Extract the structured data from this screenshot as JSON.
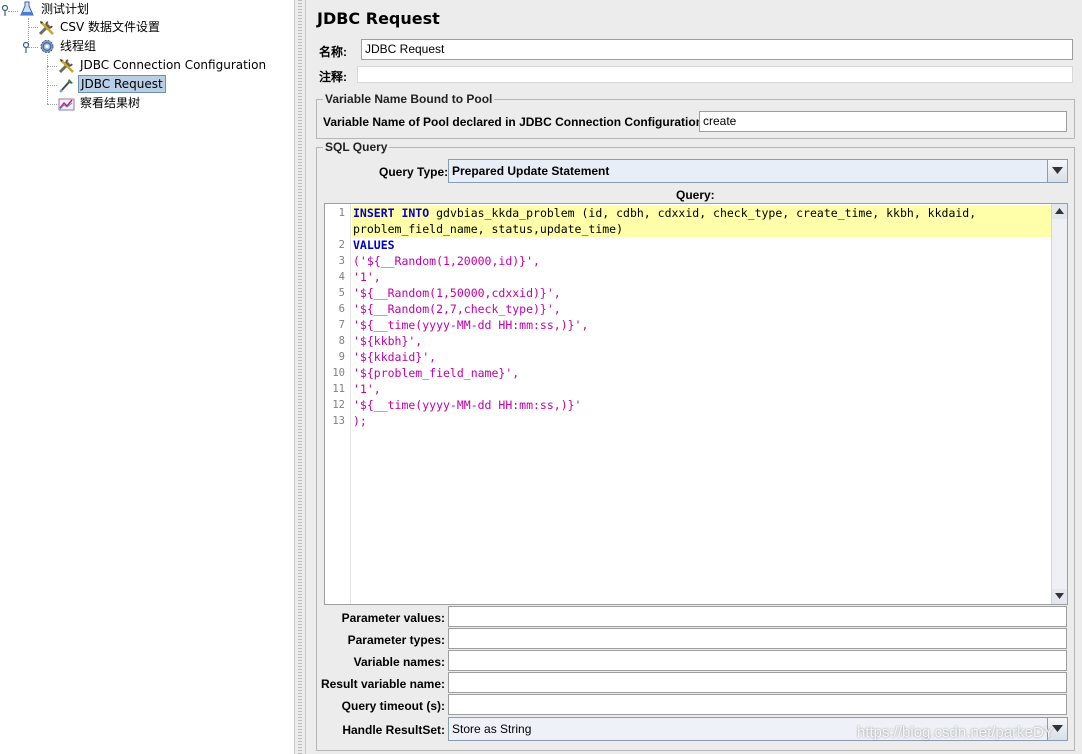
{
  "tree": {
    "items": [
      {
        "label": "测试计划",
        "icon": "flask-icon"
      },
      {
        "label": "CSV 数据文件设置",
        "icon": "wrench-icon"
      },
      {
        "label": "线程组",
        "icon": "gear-icon"
      },
      {
        "label": "JDBC Connection Configuration",
        "icon": "wrench-icon"
      },
      {
        "label": "JDBC Request",
        "icon": "pipette-icon",
        "selected": true
      },
      {
        "label": "察看结果树",
        "icon": "chart-icon"
      }
    ]
  },
  "panel": {
    "title": "JDBC Request",
    "name_label": "名称:",
    "name_value": "JDBC Request",
    "comment_label": "注释:",
    "comment_value": ""
  },
  "pool_group": {
    "legend": "Variable Name Bound to Pool",
    "pool_label": "Variable Name of Pool declared in JDBC Connection Configuration:",
    "pool_value": "create"
  },
  "sql_group": {
    "legend": "SQL Query",
    "query_type_label": "Query Type:",
    "query_type_value": "Prepared Update Statement",
    "query_label": "Query:",
    "code_lines": [
      {
        "n": "1",
        "parts": [
          [
            "kw",
            "INSERT INTO"
          ],
          [
            "pl",
            " gdvbias_kkda_problem (id, cdbh, cdxxid, check_type, create_time, kkbh, kkdaid,"
          ]
        ]
      },
      {
        "n": "",
        "parts": [
          [
            "pl",
            "problem_field_name, status,update_time)"
          ]
        ]
      },
      {
        "n": "2",
        "parts": [
          [
            "kw",
            "VALUES"
          ]
        ]
      },
      {
        "n": "3",
        "parts": [
          [
            "str",
            "('${__Random(1,20000,id)}',"
          ]
        ]
      },
      {
        "n": "4",
        "parts": [
          [
            "str",
            "'1',"
          ]
        ]
      },
      {
        "n": "5",
        "parts": [
          [
            "str",
            "'${__Random(1,50000,cdxxid)}',"
          ]
        ]
      },
      {
        "n": "6",
        "parts": [
          [
            "str",
            "'${__Random(2,7,check_type)}',"
          ]
        ]
      },
      {
        "n": "7",
        "parts": [
          [
            "str",
            "'${__time(yyyy-MM-dd HH:mm:ss,)}',"
          ]
        ]
      },
      {
        "n": "8",
        "parts": [
          [
            "str",
            "'${kkbh}',"
          ]
        ]
      },
      {
        "n": "9",
        "parts": [
          [
            "str",
            "'${kkdaid}',"
          ]
        ]
      },
      {
        "n": "10",
        "parts": [
          [
            "str",
            "'${problem_field_name}',"
          ]
        ]
      },
      {
        "n": "11",
        "parts": [
          [
            "str",
            "'1',"
          ]
        ]
      },
      {
        "n": "12",
        "parts": [
          [
            "str",
            "'${__time(yyyy-MM-dd HH:mm:ss,)}'"
          ]
        ]
      },
      {
        "n": "13",
        "parts": [
          [
            "str",
            ");"
          ]
        ]
      }
    ]
  },
  "params": {
    "parameter_values_label": "Parameter values:",
    "parameter_values": "",
    "parameter_types_label": "Parameter types:",
    "parameter_types": "",
    "variable_names_label": "Variable names:",
    "variable_names": "",
    "result_variable_name_label": "Result variable name:",
    "result_variable_name": "",
    "query_timeout_label": "Query timeout (s):",
    "query_timeout": "",
    "handle_resultset_label": "Handle ResultSet:",
    "handle_resultset_value": "Store as String"
  },
  "watermark": "https://blog.csdn.net/parkeDY"
}
